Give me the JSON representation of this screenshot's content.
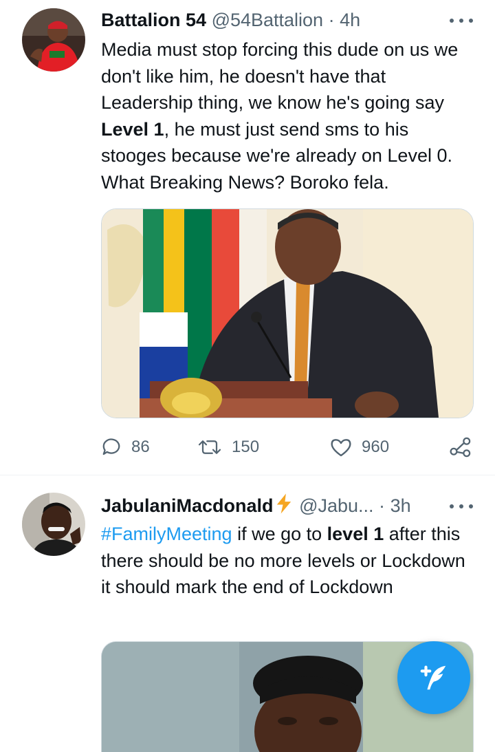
{
  "tweets": [
    {
      "display_name": "Battalion 54",
      "handle": "@54Battalion",
      "separator": "·",
      "time": "4h",
      "text_parts": {
        "p1": "Media must stop forcing this dude on us we don't like him, he doesn't have that Leadership thing, we know he's going say ",
        "bold1": "Level 1",
        "p2": ", he must just send sms to his stooges because we're already on Level 0. What Breaking News? Boroko fela."
      },
      "replies": "86",
      "retweets": "150",
      "likes": "960"
    },
    {
      "display_name": "JabulaniMacdonald",
      "badge": "⚡",
      "handle": "@Jabu...",
      "separator": "·",
      "time": "3h",
      "text_parts": {
        "hashtag": "#FamilyMeeting",
        "p1": " if we go to ",
        "bold1": "level 1",
        "p2": " after this there should be no more levels or Lockdown it should mark the end of Lockdown"
      }
    }
  ],
  "icons": {
    "reply": "reply-icon",
    "retweet": "retweet-icon",
    "like": "heart-icon",
    "share": "share-icon",
    "more": "more-icon",
    "compose": "compose-tweet-icon"
  },
  "colors": {
    "accent": "#1d9bf0",
    "text_primary": "#0f1419",
    "text_secondary": "#536471",
    "lightning": "#f5a623"
  }
}
